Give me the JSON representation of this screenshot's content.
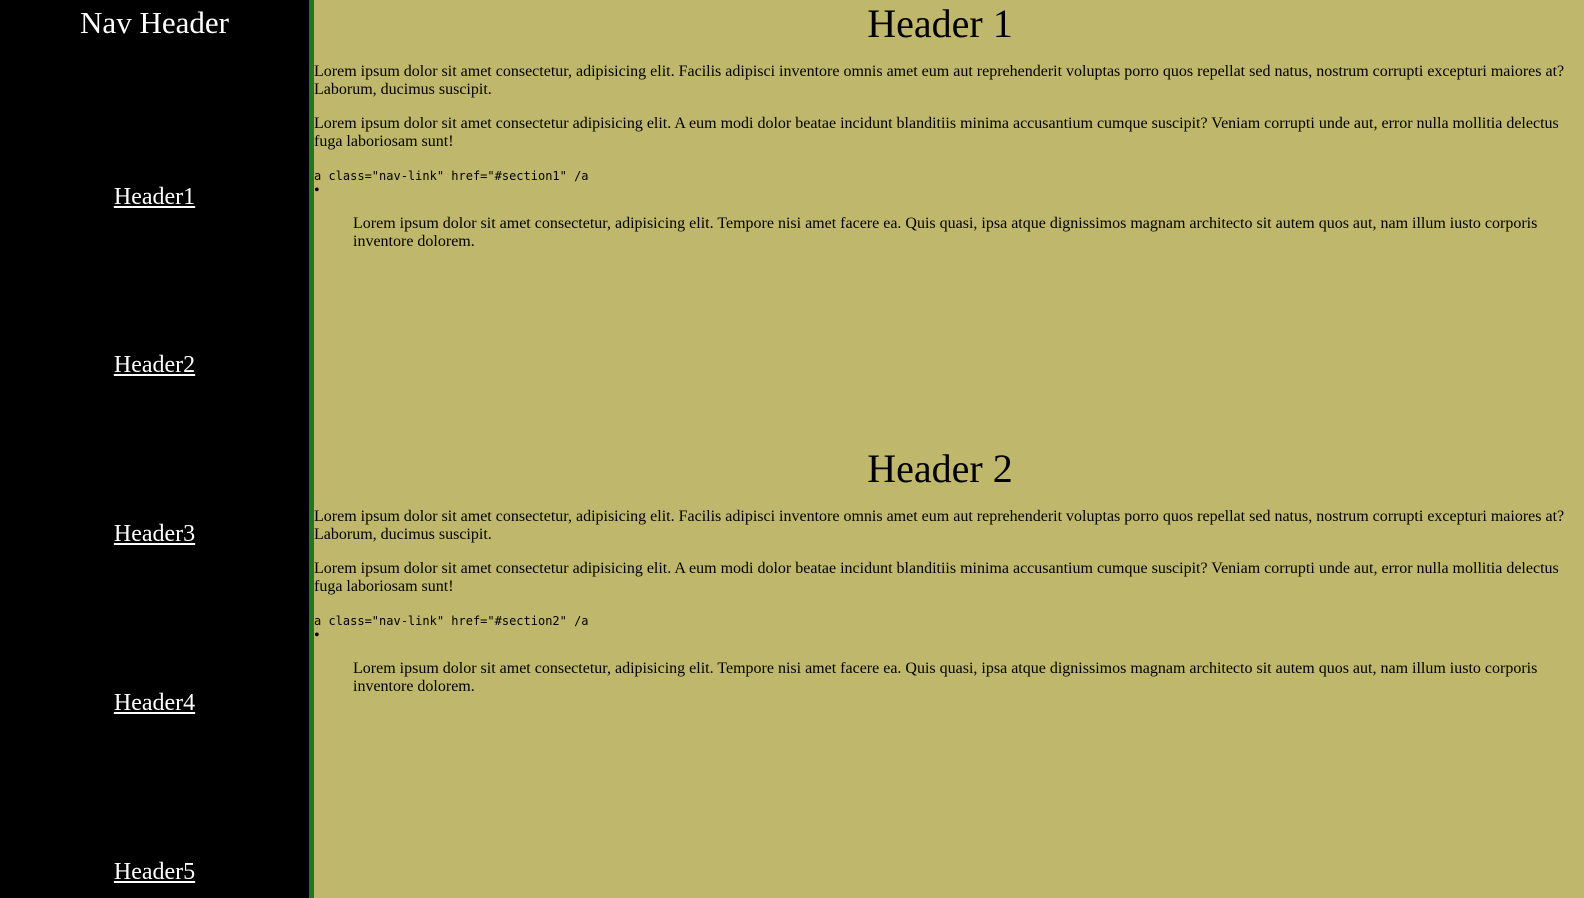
{
  "nav": {
    "header": "Nav Header",
    "links": [
      "Header1",
      "Header2",
      "Header3",
      "Header4",
      "Header5"
    ]
  },
  "sections": [
    {
      "title": "Header 1",
      "p1": "Lorem ipsum dolor sit amet consectetur, adipisicing elit. Facilis adipisci inventore omnis amet eum aut reprehenderit voluptas porro quos repellat sed natus, nostrum corrupti excepturi maiores at? Laborum, ducimus suscipit.",
      "p2": "Lorem ipsum dolor sit amet consectetur adipisicing elit. A eum modi dolor beatae incidunt blanditiis minima accusantium cumque suscipit? Veniam corrupti unde aut, error nulla mollitia delectus fuga laboriosam sunt!",
      "code": "a class=\"nav-link\" href=\"#section1\" /a",
      "bullet": "•",
      "p3": "Lorem ipsum dolor sit amet consectetur, adipisicing elit. Tempore nisi amet facere ea. Quis quasi, ipsa atque dignissimos magnam architecto sit autem quos aut, nam illum iusto corporis inventore dolorem."
    },
    {
      "title": "Header 2",
      "p1": "Lorem ipsum dolor sit amet consectetur, adipisicing elit. Facilis adipisci inventore omnis amet eum aut reprehenderit voluptas porro quos repellat sed natus, nostrum corrupti excepturi maiores at? Laborum, ducimus suscipit.",
      "p2": "Lorem ipsum dolor sit amet consectetur adipisicing elit. A eum modi dolor beatae incidunt blanditiis minima accusantium cumque suscipit? Veniam corrupti unde aut, error nulla mollitia delectus fuga laboriosam sunt!",
      "code": "a class=\"nav-link\" href=\"#section2\" /a",
      "bullet": "•",
      "p3": "Lorem ipsum dolor sit amet consectetur, adipisicing elit. Tempore nisi amet facere ea. Quis quasi, ipsa atque dignissimos magnam architecto sit autem quos aut, nam illum iusto corporis inventore dolorem."
    }
  ],
  "colors": {
    "sidebar_bg": "#000000",
    "sidebar_border": "#1e7a1e",
    "main_bg": "#bfb76c",
    "nav_text": "#ffffff"
  }
}
